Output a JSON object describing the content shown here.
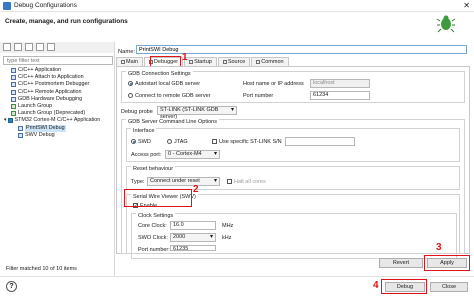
{
  "window": {
    "title": "Debug Configurations",
    "close_glyph": "✕"
  },
  "header": {
    "title": "Create, manage, and run configurations"
  },
  "filter": {
    "placeholder": "type filter text"
  },
  "tree": [
    {
      "label": "C/C++ Application",
      "indent": 1,
      "icon": "config-icon"
    },
    {
      "label": "C/C++ Attach to Application",
      "indent": 1,
      "icon": "config-icon"
    },
    {
      "label": "C/C++ Postmortem Debugger",
      "indent": 1,
      "icon": "config-icon"
    },
    {
      "label": "C/C++ Remote Application",
      "indent": 1,
      "icon": "config-icon"
    },
    {
      "label": "GDB Hardware Debugging",
      "indent": 1,
      "icon": "config-icon"
    },
    {
      "label": "Launch Group",
      "indent": 1,
      "icon": "launch-icon"
    },
    {
      "label": "Launch Group (Deprecated)",
      "indent": 1,
      "icon": "launch-icon"
    },
    {
      "label": "STM32 Cortex-M C/C++ Application",
      "indent": 0,
      "icon": "stm32-icon",
      "expanded": true
    },
    {
      "label": "PrintSWI Debug",
      "indent": 2,
      "icon": "config-icon",
      "selected": true
    },
    {
      "label": "SWV Debug",
      "indent": 2,
      "icon": "config-icon"
    }
  ],
  "status": "Filter matched 10 of 10 items",
  "name": {
    "label": "Name:",
    "value": "PrintSWI Debug"
  },
  "tabs": [
    "Main",
    "Debugger",
    "Startup",
    "Source",
    "Common"
  ],
  "gdb_connection": {
    "title": "GDB Connection Settings",
    "autostart": "Autostart local GDB server",
    "remote": "Connect to remote GDB server",
    "host_label": "Host name or IP address",
    "host_value": "localhost",
    "port_label": "Port number",
    "port_value": "61234"
  },
  "probe": {
    "label": "Debug probe",
    "value": "ST-LINK (ST-LINK GDB server)"
  },
  "gdb_server_options": {
    "title": "GDB Server Command Line Options",
    "interface_title": "Interface",
    "swd": "SWD",
    "jtag": "JTAG",
    "use_serial": "Use specific ST-LINK S/N",
    "access_port_label": "Access port:",
    "access_port_value": "0 - Cortex-M4",
    "reset_title": "Reset behaviour",
    "type_label": "Type:",
    "type_value": "Connect under reset",
    "halt_all": "Halt all cores"
  },
  "swv": {
    "title": "Serial Wire Viewer (SWV)",
    "enable": "Enable",
    "clock_title": "Clock Settings",
    "core_clock_label": "Core Clock:",
    "core_clock_value": "16.0",
    "core_clock_unit": "MHz",
    "swo_clock_label": "SWO Clock:",
    "swo_clock_value": "2000",
    "swo_clock_unit": "kHz",
    "port_number_label": "Port number:",
    "port_number_value": "61235"
  },
  "buttons": {
    "revert": "Revert",
    "apply": "Apply",
    "debug": "Debug",
    "close": "Close",
    "help": "?"
  },
  "annotations": [
    "1",
    "2",
    "3",
    "4"
  ],
  "colors": {
    "accent": "#e0121a",
    "selection": "#cce4f7",
    "bug": "#3e9a3e"
  }
}
